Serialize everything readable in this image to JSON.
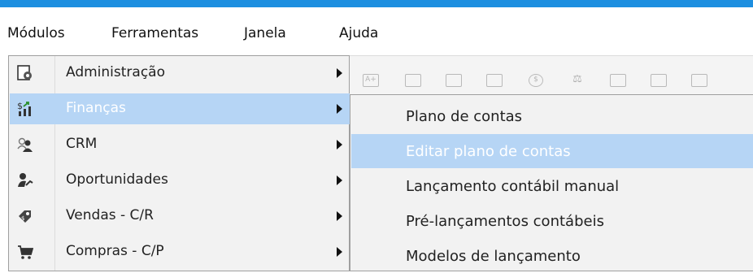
{
  "menubar": {
    "items": [
      {
        "label": "Módulos"
      },
      {
        "label": "Ferramentas"
      },
      {
        "label": "Janela"
      },
      {
        "label": "Ajuda"
      }
    ]
  },
  "modules_menu": {
    "items": [
      {
        "label": "Administração",
        "icon": "admin-gear-icon"
      },
      {
        "label": "Finanças",
        "icon": "finance-chart-icon",
        "highlighted": true
      },
      {
        "label": "CRM",
        "icon": "crm-users-icon"
      },
      {
        "label": "Oportunidades",
        "icon": "opportunities-icon"
      },
      {
        "label": "Vendas - C/R",
        "icon": "sales-icon"
      },
      {
        "label": "Compras - C/P",
        "icon": "shopping-cart-icon"
      }
    ]
  },
  "finance_submenu": {
    "items": [
      {
        "label": "Plano de contas"
      },
      {
        "label": "Editar plano de contas",
        "highlighted": true
      },
      {
        "label": "Lançamento contábil manual"
      },
      {
        "label": "Pré-lançamentos contábeis"
      },
      {
        "label": "Modelos de lançamento"
      }
    ]
  },
  "colors": {
    "accent_bar": "#1d8fe0",
    "highlight": "#b6d5f5",
    "menu_bg": "#f2f2f2"
  }
}
